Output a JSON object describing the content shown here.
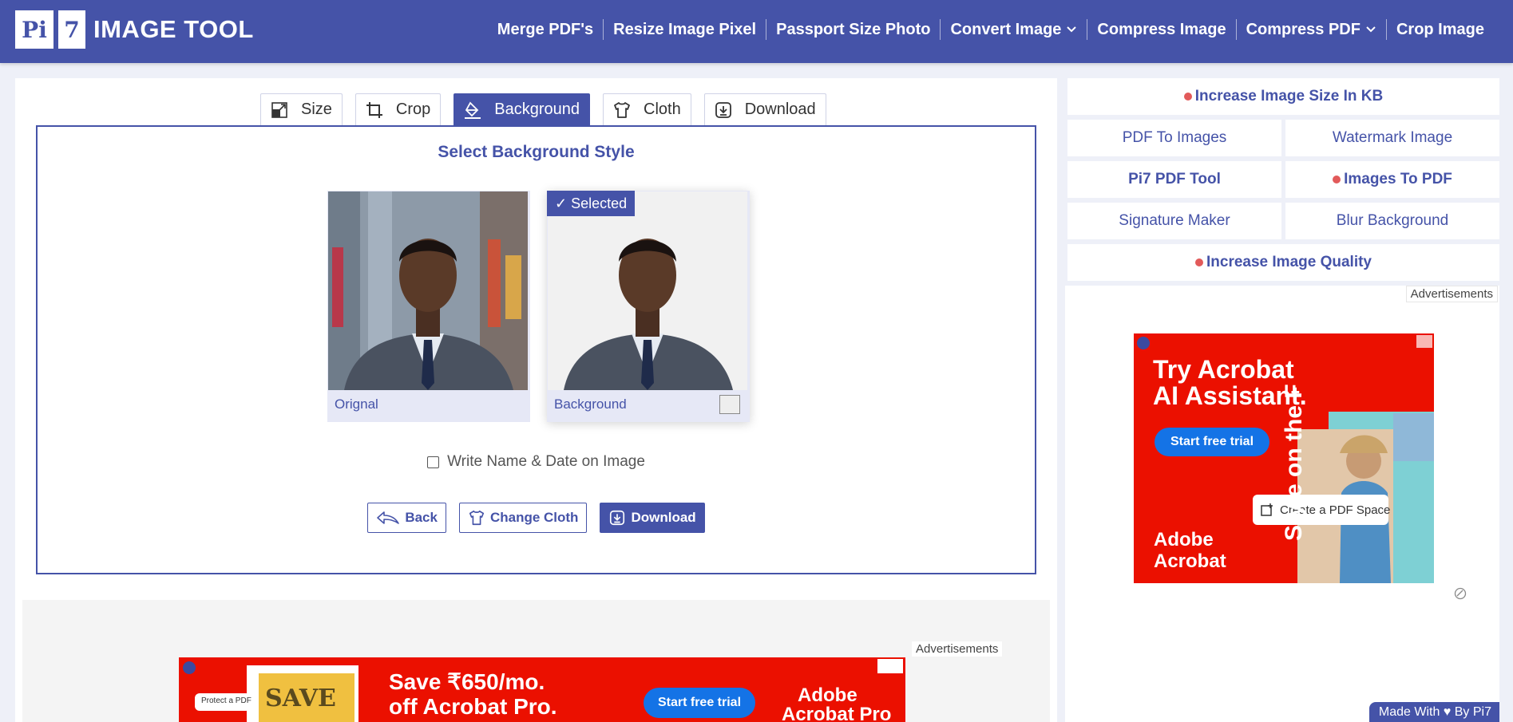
{
  "logo": {
    "part1": "Pi",
    "part2": "7",
    "text": "IMAGE TOOL"
  },
  "nav": [
    {
      "label": "Merge PDF's",
      "dropdown": false
    },
    {
      "label": "Resize Image Pixel",
      "dropdown": false
    },
    {
      "label": "Passport Size Photo",
      "dropdown": false
    },
    {
      "label": "Convert Image",
      "dropdown": true
    },
    {
      "label": "Compress Image",
      "dropdown": false
    },
    {
      "label": "Compress PDF",
      "dropdown": true
    },
    {
      "label": "Crop Image",
      "dropdown": false
    }
  ],
  "tabs": [
    {
      "label": "Size",
      "icon": "resize-icon",
      "active": false
    },
    {
      "label": "Crop",
      "icon": "crop-icon",
      "active": false
    },
    {
      "label": "Background",
      "icon": "paint-bucket-icon",
      "active": true
    },
    {
      "label": "Cloth",
      "icon": "shirt-icon",
      "active": false
    },
    {
      "label": "Download",
      "icon": "download-icon",
      "active": false
    }
  ],
  "editor": {
    "title": "Select Background Style",
    "original_label": "Orignal",
    "background_label": "Background",
    "selected_badge": "✓ Selected",
    "checkbox_label": "Write Name & Date on Image",
    "checkbox_checked": false,
    "back_button": "Back",
    "change_cloth_button": "Change Cloth",
    "download_button": "Download"
  },
  "ads": {
    "label": "Advertisements",
    "side": {
      "headline1": "Try Acrobat",
      "headline2": "AI Assistant.",
      "cta": "Start free trial",
      "brand1": "Adobe",
      "brand2": "Acrobat",
      "chip": "Create a PDF Space",
      "vertical": "Style on the F"
    },
    "bottom": {
      "headline1": "Save ₹650/mo.",
      "headline2": "off Acrobat Pro.",
      "cta": "Start free trial",
      "brand1": "Adobe",
      "brand2": "Acrobat Pro",
      "chip": "Protect a PDF",
      "stamp": "SAVE"
    }
  },
  "sidebar": {
    "increase_size": "Increase Image Size In KB",
    "pdf_to_images": "PDF To Images",
    "watermark": "Watermark Image",
    "pdf_tool": "Pi7 PDF Tool",
    "images_to_pdf": "Images To PDF",
    "signature": "Signature Maker",
    "blur_bg": "Blur Background",
    "increase_quality": "Increase Image Quality"
  },
  "footer": {
    "made_with": "Made With ♥ By  Pi7"
  },
  "colors": {
    "primary": "#4553a8",
    "ad_red": "#eb1000",
    "dot": "#e25a5a"
  }
}
